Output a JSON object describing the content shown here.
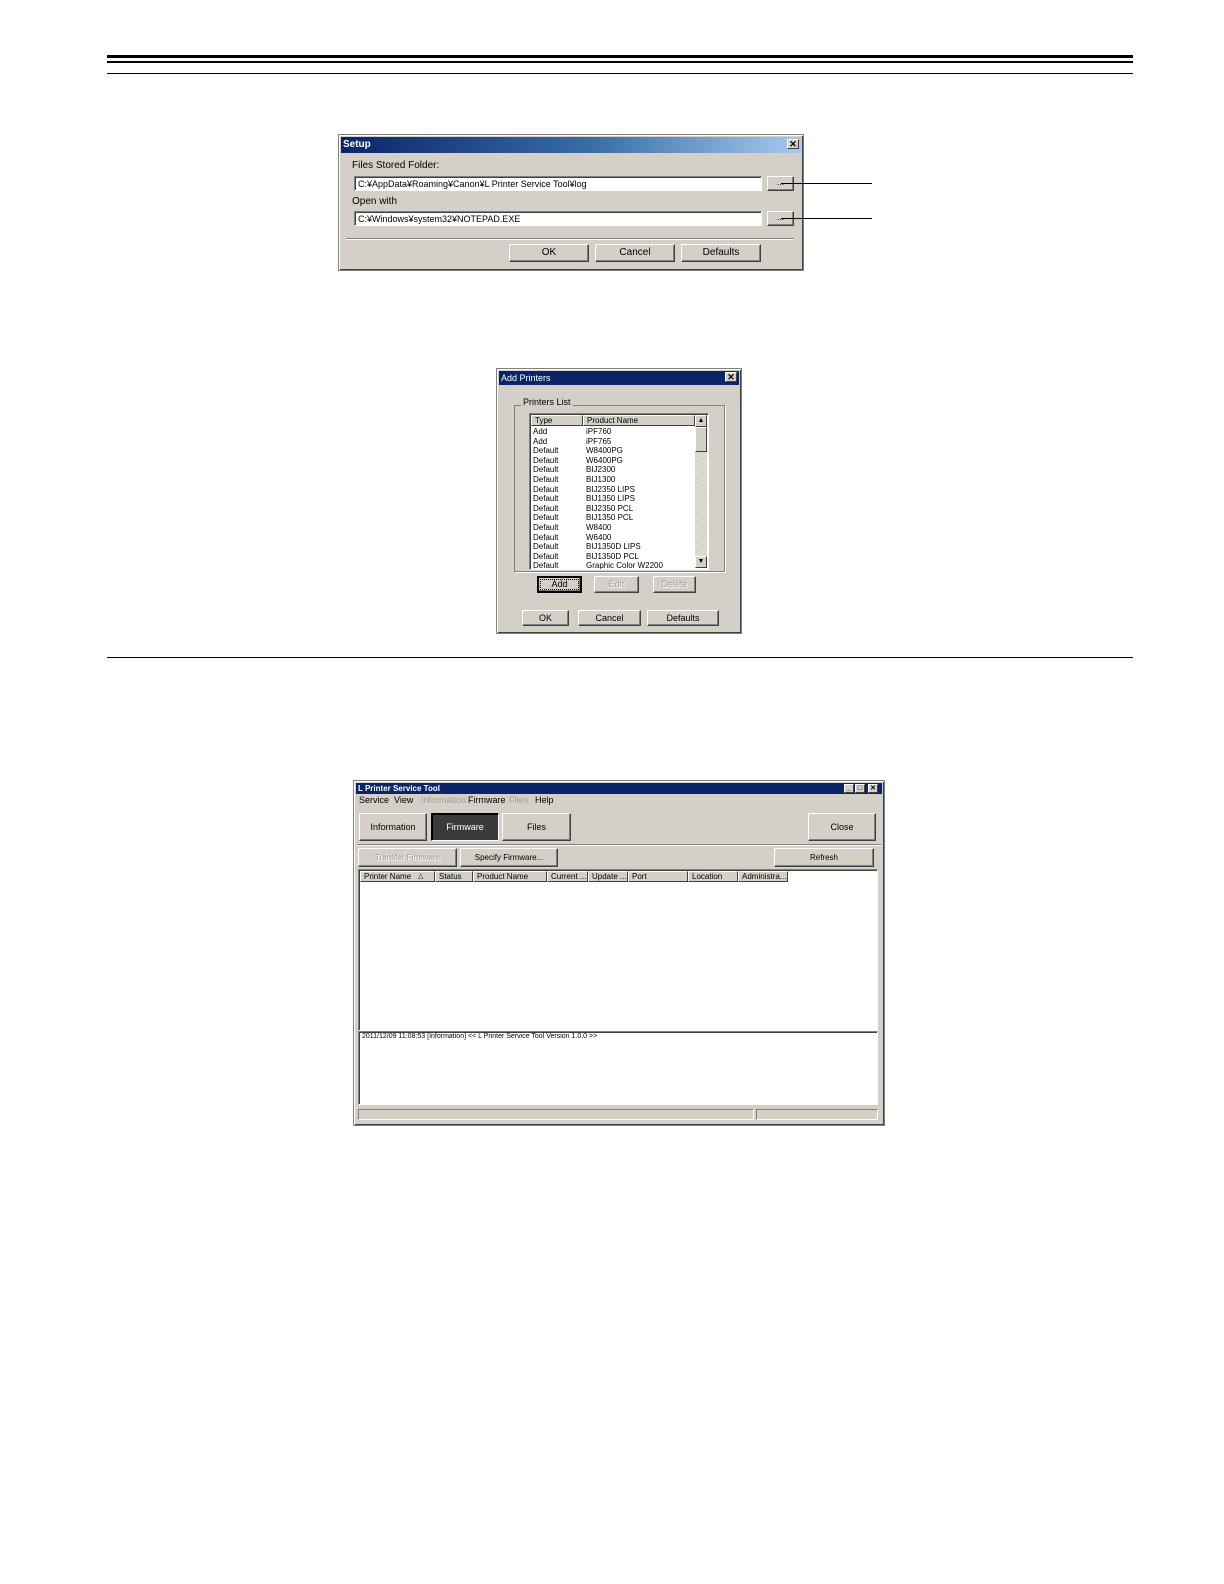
{
  "setup_dialog": {
    "title": "Setup",
    "close_glyph": "✕",
    "files_label": "Files Stored Folder:",
    "files_path": "C:¥AppData¥Roaming¥Canon¥L Printer Service Tool¥log",
    "open_label": "Open with",
    "open_path": "C:¥Windows¥system32¥NOTEPAD.EXE",
    "browse_label": "...",
    "ok": "OK",
    "cancel": "Cancel",
    "defaults": "Defaults"
  },
  "add_printers_dialog": {
    "title": "Add Printers",
    "close_glyph": "✕",
    "group_label": "Printers List",
    "columns": [
      "Type",
      "Product Name"
    ],
    "rows": [
      [
        "Add",
        "iPF760"
      ],
      [
        "Add",
        "iPF765"
      ],
      [
        "Default",
        "W8400PG"
      ],
      [
        "Default",
        "W6400PG"
      ],
      [
        "Default",
        "BIJ2300"
      ],
      [
        "Default",
        "BIJ1300"
      ],
      [
        "Default",
        "BIJ2350 LIPS"
      ],
      [
        "Default",
        "BIJ1350 LIPS"
      ],
      [
        "Default",
        "BIJ2350 PCL"
      ],
      [
        "Default",
        "BIJ1350 PCL"
      ],
      [
        "Default",
        "W8400"
      ],
      [
        "Default",
        "W6400"
      ],
      [
        "Default",
        "BIJ1350D LIPS"
      ],
      [
        "Default",
        "BIJ1350D PCL"
      ],
      [
        "Default",
        "Graphic Color W2200"
      ]
    ],
    "add": "Add",
    "edit": "Edit",
    "delete": "Delete",
    "ok": "OK",
    "cancel": "Cancel",
    "defaults": "Defaults",
    "scroll_up": "▲",
    "scroll_down": "▼"
  },
  "service_tool": {
    "title": "L Printer Service Tool",
    "window_buttons": [
      "_",
      "□",
      "✕"
    ],
    "menu": [
      "Service",
      "View",
      "Information",
      "Firmware",
      "Files",
      "Help"
    ],
    "tabs": [
      "Information",
      "Firmware",
      "Files"
    ],
    "close": "Close",
    "transfer": "Transfer Firmware",
    "specify": "Specify Firmware...",
    "refresh": "Refresh",
    "columns": [
      "Printer Name",
      "Status",
      "Product Name",
      "Current ...",
      "Update ...",
      "Port",
      "Location",
      "Administra..."
    ],
    "sort_glyph": "△",
    "log_line": "2011/12/09 11:08:53 [Information]   << L Printer Service Tool  Version 1.0.0 >>"
  }
}
